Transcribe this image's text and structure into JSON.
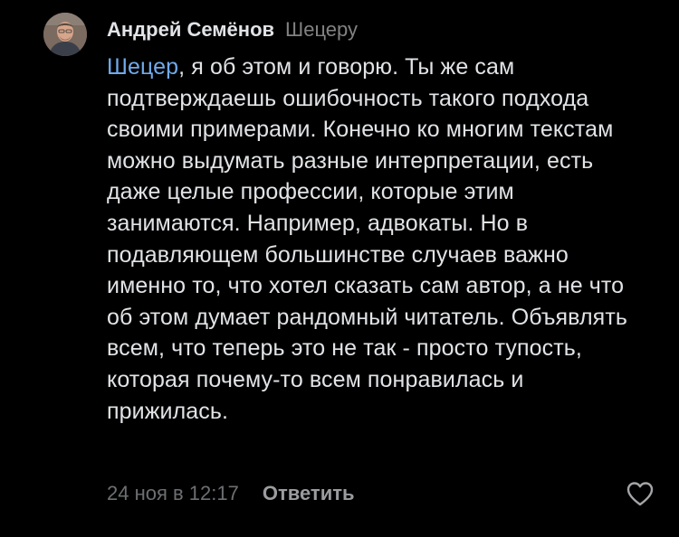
{
  "comment": {
    "author": "Андрей Семёнов",
    "reply_to": "Шецеру",
    "mention": "Шецер",
    "text": ", я об этом и говорю. Ты же сам подтверждаешь ошибочность такого подхода своими примерами. Конечно ко многим текстам можно выдумать разные интерпретации, есть даже целые профессии, которые этим занимаются. Например, адвокаты. Но в подавляющем большинстве случаев важно именно то, что хотел сказать сам автор, а не что об этом думает рандомный читатель. Объявлять всем, что теперь это не так - просто тупость, которая почему-то всем понравилась и прижилась.",
    "date": "24 ноя в 12:17",
    "reply_label": "Ответить",
    "like_icon": "heart-outline-icon",
    "avatar_icon": "user-avatar"
  },
  "colors": {
    "background": "#000000",
    "text": "#e1e3e6",
    "secondary": "#828282",
    "mention": "#71aaeb"
  }
}
